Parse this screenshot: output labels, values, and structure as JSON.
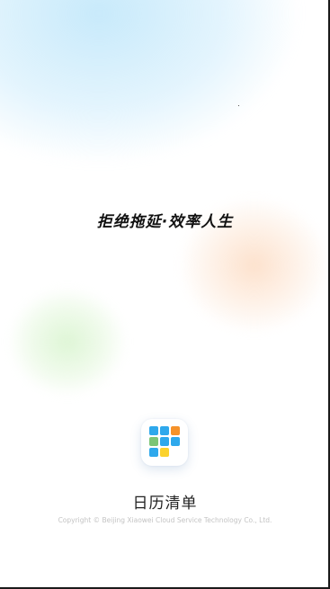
{
  "splash": {
    "slogan": "拒绝拖延·效率人生",
    "app_name": "日历清单",
    "copyright": "Copyright © Beijing Xiaowei Cloud Service Technology Co., Ltd."
  },
  "colors": {
    "background": "#ffffff",
    "blue_glow": "#cdeafb",
    "orange_glow": "#fcdcc4",
    "green_glow": "#dcf4cf",
    "icon_blue": "#2ea8ec",
    "icon_orange": "#f5922a",
    "icon_green": "#7cc576",
    "icon_yellow": "#fbd22d"
  },
  "icon": {
    "name": "calendar-grid-icon",
    "cells": [
      "blue",
      "blue",
      "orange",
      "green",
      "blue",
      "blue",
      "blue",
      "yellow"
    ]
  }
}
